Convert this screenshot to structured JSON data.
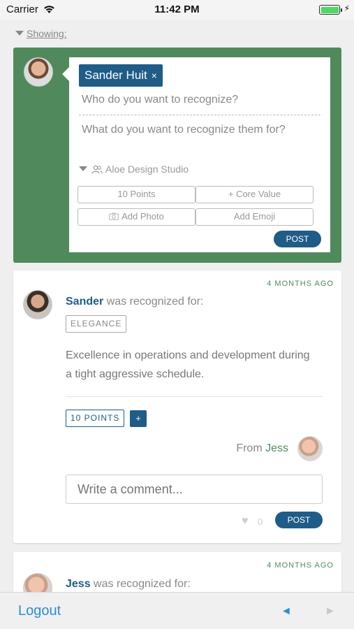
{
  "status_bar": {
    "carrier": "Carrier",
    "time": "11:42 PM",
    "battery_level": 1.0
  },
  "filter": {
    "label": "Showing:"
  },
  "compose": {
    "recipient_chip": "Sander Huit",
    "chip_remove": "×",
    "who_placeholder": "Who do you want to recognize?",
    "what_placeholder": "What do you want to recognize them for?",
    "group": "Aloe Design Studio",
    "points_button": "10 Points",
    "core_value_button": "+ Core Value",
    "add_photo_button": "Add Photo",
    "add_emoji_button": "Add Emoji",
    "post_button": "POST"
  },
  "feed": [
    {
      "time_ago": "4 MONTHS AGO",
      "recipient": "Sander",
      "recognized_text": "was recognized for:",
      "tag": "ELEGANCE",
      "description": "Excellence in operations and development during a tight aggressive schedule.",
      "points": "10 POINTS",
      "add_points": "+",
      "from_label": "From",
      "from_name": "Jess",
      "comment_placeholder": "Write a comment...",
      "likes": "0",
      "post_button": "POST"
    },
    {
      "time_ago": "4 MONTHS AGO",
      "recipient": "Jess",
      "recognized_text": "was recognized for:"
    }
  ],
  "bottom_bar": {
    "logout": "Logout",
    "prev": "◄",
    "next": "►"
  },
  "colors": {
    "green": "#508a5c",
    "blue": "#1f5c87",
    "link_blue": "#2a8fd6"
  }
}
